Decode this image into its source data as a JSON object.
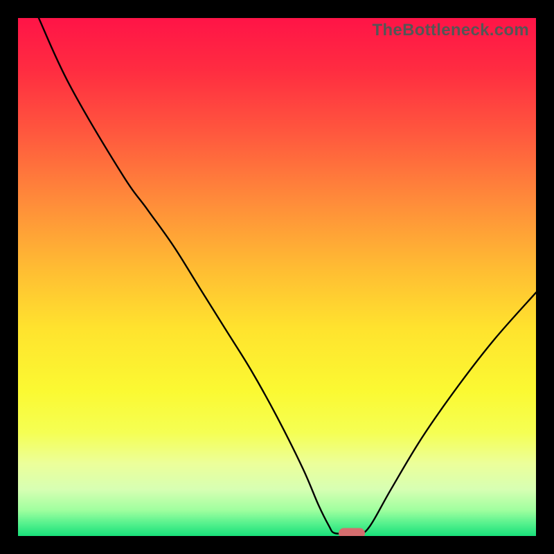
{
  "watermark": "TheBottleneck.com",
  "gradient_stops": [
    {
      "offset": 0.0,
      "color": "#ff1447"
    },
    {
      "offset": 0.1,
      "color": "#ff2c41"
    },
    {
      "offset": 0.22,
      "color": "#ff573e"
    },
    {
      "offset": 0.35,
      "color": "#ff8a3a"
    },
    {
      "offset": 0.48,
      "color": "#ffbb33"
    },
    {
      "offset": 0.6,
      "color": "#ffe32e"
    },
    {
      "offset": 0.72,
      "color": "#fbf932"
    },
    {
      "offset": 0.8,
      "color": "#f5ff53"
    },
    {
      "offset": 0.86,
      "color": "#ecff9a"
    },
    {
      "offset": 0.91,
      "color": "#d7ffb3"
    },
    {
      "offset": 0.95,
      "color": "#a0ff9f"
    },
    {
      "offset": 0.975,
      "color": "#58f28e"
    },
    {
      "offset": 1.0,
      "color": "#18e07a"
    }
  ],
  "chart_data": {
    "type": "line",
    "title": "",
    "xlabel": "",
    "ylabel": "",
    "xlim": [
      0,
      100
    ],
    "ylim": [
      0,
      100
    ],
    "series": [
      {
        "name": "bottleneck-curve",
        "points": [
          {
            "x": 4.0,
            "y": 100.0
          },
          {
            "x": 10.0,
            "y": 87.0
          },
          {
            "x": 20.0,
            "y": 70.0
          },
          {
            "x": 25.0,
            "y": 63.0
          },
          {
            "x": 30.0,
            "y": 56.0
          },
          {
            "x": 35.0,
            "y": 48.0
          },
          {
            "x": 40.0,
            "y": 40.0
          },
          {
            "x": 45.0,
            "y": 32.0
          },
          {
            "x": 50.0,
            "y": 23.0
          },
          {
            "x": 55.0,
            "y": 13.0
          },
          {
            "x": 58.0,
            "y": 6.0
          },
          {
            "x": 60.0,
            "y": 2.0
          },
          {
            "x": 61.0,
            "y": 0.6
          },
          {
            "x": 63.0,
            "y": 0.5
          },
          {
            "x": 66.0,
            "y": 0.5
          },
          {
            "x": 68.0,
            "y": 2.0
          },
          {
            "x": 72.0,
            "y": 9.0
          },
          {
            "x": 78.0,
            "y": 19.0
          },
          {
            "x": 85.0,
            "y": 29.0
          },
          {
            "x": 92.0,
            "y": 38.0
          },
          {
            "x": 100.0,
            "y": 47.0
          }
        ]
      }
    ],
    "marker": {
      "x": 64.5,
      "y": 0.5,
      "color": "#d56d6e"
    }
  }
}
